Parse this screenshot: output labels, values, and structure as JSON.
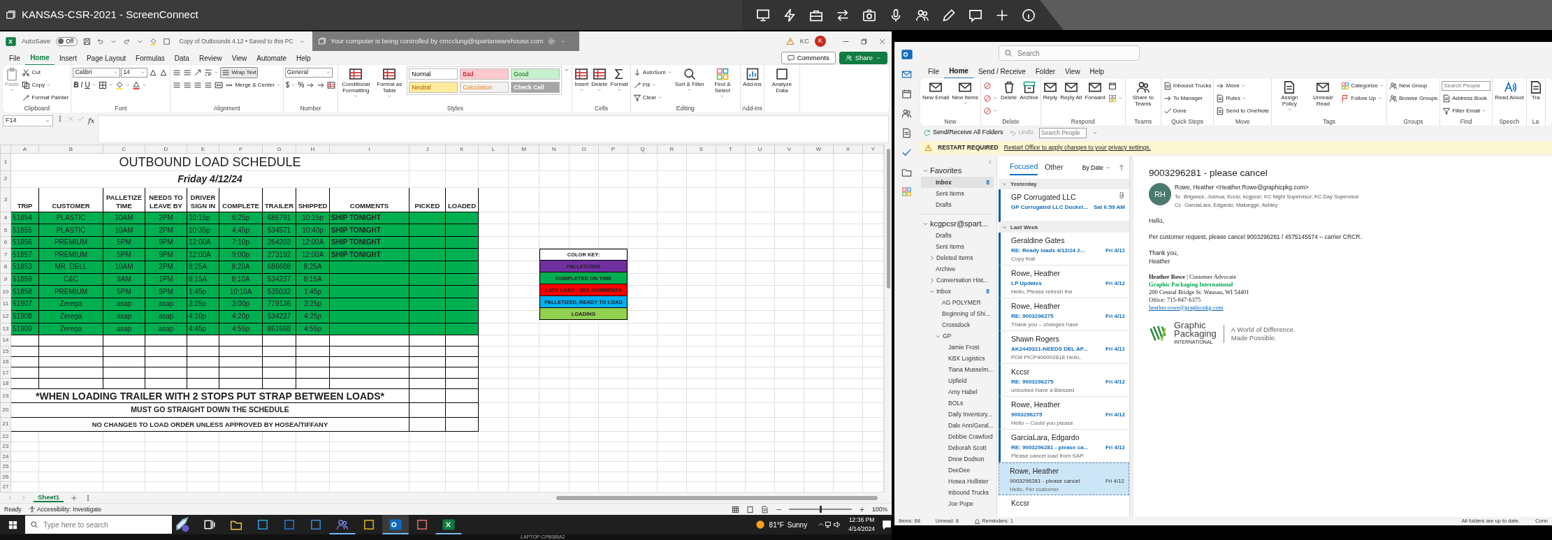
{
  "remote_session": {
    "title": "KANSAS-CSR-2021 - ScreenConnect",
    "banner": "Your computer is being controlled by cmcclung@spartanwarehouse.com"
  },
  "excel": {
    "autosave": {
      "label": "AutoSave",
      "state": "Off",
      "on": false
    },
    "file_title": "Copy of Outbounds 4.12 • Saved to this PC",
    "user": {
      "initials": "KC",
      "avatar": "K"
    },
    "menu_tabs": [
      {
        "label": "File",
        "selected": false
      },
      {
        "label": "Home",
        "selected": true
      },
      {
        "label": "Insert",
        "selected": false
      },
      {
        "label": "Page Layout",
        "selected": false
      },
      {
        "label": "Formulas",
        "selected": false
      },
      {
        "label": "Data",
        "selected": false
      },
      {
        "label": "Review",
        "selected": false
      },
      {
        "label": "View",
        "selected": false
      },
      {
        "label": "Automate",
        "selected": false
      },
      {
        "label": "Help",
        "selected": false
      }
    ],
    "comments": "Comments",
    "share": "Share",
    "ribbon": [
      {
        "label": "Clipboard",
        "items": [
          {
            "kind": "large",
            "label": "Paste",
            "dropdown": true,
            "disabled": true
          },
          {
            "kind": "stack",
            "lines": [
              {
                "items": [
                  {
                    "kind": "button",
                    "label": "Cut"
                  }
                ]
              },
              {
                "items": [
                  {
                    "kind": "button",
                    "label": "Copy",
                    "dropdown": true
                  }
                ]
              },
              {
                "items": [
                  {
                    "kind": "button",
                    "label": "Format Painter"
                  }
                ]
              }
            ]
          }
        ]
      },
      {
        "label": "Font",
        "items": [
          {
            "kind": "stack",
            "lines": [
              {
                "items": [
                  {
                    "kind": "field",
                    "value": "Calibri",
                    "dropdown": true
                  },
                  {
                    "kind": "field",
                    "value": "14",
                    "dropdown": true
                  },
                  {
                    "kind": "icon"
                  },
                  {
                    "kind": "icon"
                  }
                ]
              },
              {
                "items": [
                  {
                    "kind": "bold",
                    "label": "B"
                  },
                  {
                    "kind": "italic",
                    "label": "I"
                  },
                  {
                    "kind": "underline",
                    "label": "U",
                    "dropdown": true
                  },
                  {
                    "kind": "icon",
                    "dropdown": true
                  },
                  {
                    "kind": "icon",
                    "dropdown": true
                  },
                  {
                    "kind": "icon",
                    "dropdown": true
                  }
                ]
              }
            ]
          }
        ]
      },
      {
        "label": "Alignment",
        "items": [
          {
            "kind": "stack",
            "lines": [
              {
                "items": [
                  {
                    "kind": "icon"
                  },
                  {
                    "kind": "icon"
                  },
                  {
                    "kind": "icon"
                  },
                  {
                    "kind": "icon",
                    "dropdown": true
                  },
                  {
                    "kind": "toggle",
                    "label": "Wrap Text",
                    "on": true
                  }
                ]
              },
              {
                "items": [
                  {
                    "kind": "icon"
                  },
                  {
                    "kind": "icon"
                  },
                  {
                    "kind": "icon"
                  },
                  {
                    "kind": "icon"
                  },
                  {
                    "kind": "icon"
                  },
                  {
                    "kind": "button",
                    "label": "Merge & Center",
                    "dropdown": true
                  }
                ]
              }
            ]
          }
        ]
      },
      {
        "label": "Number",
        "items": [
          {
            "kind": "stack",
            "lines": [
              {
                "items": [
                  {
                    "kind": "field",
                    "value": "General",
                    "dropdown": true
                  }
                ]
              },
              {
                "items": [
                  {
                    "kind": "glyph",
                    "label": "$",
                    "dropdown": true
                  },
                  {
                    "kind": "glyph",
                    "label": "%"
                  },
                  {
                    "kind": "icon"
                  },
                  {
                    "kind": "icon"
                  },
                  {
                    "kind": "icon"
                  }
                ]
              }
            ]
          }
        ]
      },
      {
        "label": "Styles",
        "items": [
          {
            "kind": "large",
            "label": "Conditional Formatting",
            "dropdown": true
          },
          {
            "kind": "large",
            "label": "Format as Table",
            "dropdown": true
          },
          {
            "kind": "gallery",
            "styles": [
              {
                "label": "Normal",
                "color": "#ffffff"
              },
              {
                "label": "Bad",
                "color": "#ffc7ce"
              },
              {
                "label": "Good",
                "color": "#c6efce"
              },
              {
                "label": "Neutral",
                "color": "#ffeb9c"
              },
              {
                "label": "Calculation",
                "color": "#f2f2f2"
              },
              {
                "label": "Check Cell",
                "color": "#a5a5a5"
              }
            ]
          }
        ]
      },
      {
        "label": "Cells",
        "items": [
          {
            "kind": "large",
            "label": "Insert",
            "dropdown": true
          },
          {
            "kind": "large",
            "label": "Delete",
            "dropdown": true
          },
          {
            "kind": "large",
            "label": "Format",
            "dropdown": true
          }
        ]
      },
      {
        "label": "Editing",
        "items": [
          {
            "kind": "stack",
            "lines": [
              {
                "items": [
                  {
                    "kind": "button",
                    "label": "AutoSum",
                    "dropdown": true
                  }
                ]
              },
              {
                "items": [
                  {
                    "kind": "button",
                    "label": "Fill",
                    "dropdown": true
                  }
                ]
              },
              {
                "items": [
                  {
                    "kind": "button",
                    "label": "Clear",
                    "dropdown": true
                  }
                ]
              }
            ]
          },
          {
            "kind": "large",
            "label": "Sort & Filter",
            "dropdown": true
          },
          {
            "kind": "large",
            "label": "Find & Select",
            "dropdown": true
          }
        ]
      },
      {
        "label": "Add-ins",
        "items": [
          {
            "kind": "large",
            "label": "Add-ins"
          }
        ]
      },
      {
        "items": [
          {
            "kind": "large",
            "label": "Analyze Data"
          }
        ]
      }
    ],
    "name_box": "F14",
    "function_label": "fx",
    "sheet": {
      "columns": [
        "A",
        "B",
        "C",
        "D",
        "E",
        "F",
        "G",
        "H",
        "I",
        "J",
        "K",
        "L",
        "M",
        "N",
        "O",
        "P",
        "Q",
        "R",
        "S",
        "T",
        "U",
        "V",
        "W",
        "X",
        "Y"
      ],
      "row_numbers": [
        "1",
        "2",
        "3",
        "4",
        "5",
        "6",
        "7",
        "8",
        "9",
        "10",
        "11",
        "12",
        "13",
        "14",
        "15",
        "16",
        "17",
        "18",
        "19",
        "20",
        "21",
        "22",
        "23",
        "24",
        "25",
        "26",
        "27"
      ],
      "title": "OUTBOUND LOAD SCHEDULE",
      "date": "Friday 4/12/24",
      "headers": [
        "TRIP",
        "CUSTOMER",
        "PALLETIZE TIME",
        "NEEDS TO LEAVE BY",
        "DRIVER SIGN IN",
        "COMPLETE",
        "TRAILER",
        "SHIPPED",
        "COMMENTS",
        "PICKED",
        "LOADED"
      ],
      "loads": [
        {
          "trip": "51854",
          "customer": "PLASTIC",
          "palletize": "10AM",
          "leave_by": "2PM",
          "sign_in": "10:15p",
          "complete": "6:25p",
          "trailer": "686791",
          "shipped": "10:15p",
          "comment": "SHIP TONIGHT",
          "color": "#00b050"
        },
        {
          "trip": "51855",
          "customer": "PLASTIC",
          "palletize": "10AM",
          "leave_by": "2PM",
          "sign_in": "10:35p",
          "complete": "4:45p",
          "trailer": "534571",
          "shipped": "10:40p",
          "comment": "SHIP TONIGHT",
          "color": "#00b050"
        },
        {
          "trip": "51856",
          "customer": "PREMIUM",
          "palletize": "5PM",
          "leave_by": "9PM",
          "sign_in": "12:00A",
          "complete": "7:10p",
          "trailer": "264203",
          "shipped": "12:00A",
          "comment": "SHIP TONIGHT",
          "color": "#00b050"
        },
        {
          "trip": "51857",
          "customer": "PREMIUM",
          "palletize": "5PM",
          "leave_by": "9PM",
          "sign_in": "12:00A",
          "complete": "9:00p",
          "trailer": "273192",
          "shipped": "12:00A",
          "comment": "SHIP TONIGHT",
          "color": "#00b050"
        },
        {
          "trip": "51853",
          "customer": "MR. DELL",
          "palletize": "10AM",
          "leave_by": "2PM",
          "sign_in": "8:25A",
          "complete": "8:20A",
          "trailer": "686688",
          "shipped": "8:25A",
          "color": "#00b050"
        },
        {
          "trip": "51859",
          "customer": "C&C",
          "palletize": "9AM",
          "leave_by": "1PM",
          "sign_in": "8:15A",
          "complete": "8:10A",
          "trailer": "534237",
          "shipped": "8:15A",
          "color": "#00b050"
        },
        {
          "trip": "51858",
          "customer": "PREMIUM",
          "palletize": "5PM",
          "leave_by": "9PM",
          "sign_in": "1:45p",
          "complete": "10:10A",
          "trailer": "535032",
          "shipped": "1:45p",
          "color": "#00b050"
        },
        {
          "trip": "51907",
          "customer": "Zerega",
          "palletize": "asap",
          "leave_by": "asap",
          "sign_in": "3:25p",
          "complete": "3:00p",
          "trailer": "779136",
          "shipped": "3:25p",
          "color": "#00b050"
        },
        {
          "trip": "51908",
          "customer": "Zerega",
          "palletize": "asap",
          "leave_by": "asap",
          "sign_in": "4:10p",
          "complete": "4:20p",
          "trailer": "534237",
          "shipped": "4:25p",
          "color": "#00b050"
        },
        {
          "trip": "51909",
          "customer": "Zerega",
          "palletize": "asap",
          "leave_by": "asap",
          "sign_in": "4:45p",
          "complete": "4:55p",
          "trailer": "861668",
          "shipped": "4:55p",
          "color": "#00b050"
        }
      ],
      "notes": [
        "*WHEN LOADING TRAILER WITH 2 STOPS PUT STRAP BETWEEN LOADS*",
        "MUST GO STRAIGHT DOWN THE SCHEDULE",
        "NO CHANGES TO LOAD ORDER UNLESS APPROVED BY HOSEA/TIFFANY"
      ],
      "color_key": {
        "title": "COLOR KEY:",
        "items": [
          {
            "label": "PALLETIZING",
            "color": "#7030a0"
          },
          {
            "label": "COMPLETED ON TIME",
            "color": "#00b050"
          },
          {
            "label": "LATE LOAD - SEE COMMENTS",
            "color": "#ff0000"
          },
          {
            "label": "PALLETIZED, READY TO LOAD",
            "color": "#00b0f0"
          },
          {
            "label": "LOADING",
            "color": "#92d050"
          }
        ]
      }
    },
    "sheet_tabs": [
      {
        "label": "Sheet1",
        "selected": true
      }
    ],
    "status": {
      "ready": "Ready",
      "accessibility": "Accessibility: Investigate",
      "zoom": "100%",
      "level": 0.5
    }
  },
  "taskbar": {
    "search_placeholder": "Type here to search",
    "apps": [
      {
        "running": false,
        "selected": false
      },
      {
        "running": false,
        "selected": false
      },
      {
        "running": false,
        "selected": false
      },
      {
        "running": false,
        "selected": false
      },
      {
        "running": false,
        "selected": false
      },
      {
        "running": true,
        "selected": false
      },
      {
        "running": false,
        "selected": false
      },
      {
        "running": true,
        "selected": true
      },
      {
        "running": false,
        "selected": false
      },
      {
        "running": true,
        "selected": false
      }
    ],
    "temperature": "81°F",
    "condition": "Sunny",
    "time": "12:36 PM",
    "date": "4/14/2024",
    "machine": "LAPTOP-CP8086A2"
  },
  "outlook": {
    "search_placeholder": "Search",
    "tabs": [
      {
        "label": "File",
        "selected": false
      },
      {
        "label": "Home",
        "selected": true
      },
      {
        "label": "Send / Receive",
        "selected": false
      },
      {
        "label": "Folder",
        "selected": false
      },
      {
        "label": "View",
        "selected": false
      },
      {
        "label": "Help",
        "selected": false
      }
    ],
    "ribbon": [
      {
        "label": "New",
        "items": [
          {
            "kind": "large",
            "label": "New Email"
          },
          {
            "kind": "large",
            "label": "New Items",
            "dropdown": true
          }
        ]
      },
      {
        "label": "Delete",
        "items": [
          {
            "kind": "stack",
            "lines": [
              {
                "items": [
                  {
                    "kind": "icon"
                  }
                ]
              },
              {
                "items": [
                  {
                    "kind": "icon",
                    "dropdown": true
                  }
                ]
              },
              {
                "items": [
                  {
                    "kind": "icon",
                    "dropdown": true
                  }
                ]
              }
            ]
          },
          {
            "kind": "large",
            "label": "Delete"
          },
          {
            "kind": "large",
            "label": "Archive"
          }
        ]
      },
      {
        "label": "Respond",
        "items": [
          {
            "kind": "large",
            "label": "Reply"
          },
          {
            "kind": "large",
            "label": "Reply All"
          },
          {
            "kind": "large",
            "label": "Forward"
          },
          {
            "kind": "stack",
            "lines": [
              {
                "items": [
                  {
                    "kind": "icon"
                  }
                ]
              },
              {
                "items": [
                  {
                    "kind": "icon",
                    "dropdown": true
                  }
                ]
              }
            ]
          }
        ]
      },
      {
        "label": "Teams",
        "items": [
          {
            "kind": "large",
            "label": "Share to Teams"
          }
        ]
      },
      {
        "label": "Quick Steps",
        "items": [
          {
            "kind": "stack",
            "lines": [
              {
                "items": [
                  {
                    "kind": "button",
                    "label": "Inbound Trucks"
                  }
                ]
              },
              {
                "items": [
                  {
                    "kind": "button",
                    "label": "To Manager"
                  }
                ]
              },
              {
                "items": [
                  {
                    "kind": "button",
                    "label": "Done"
                  }
                ]
              }
            ]
          }
        ]
      },
      {
        "label": "Move",
        "items": [
          {
            "kind": "stack",
            "lines": [
              {
                "items": [
                  {
                    "kind": "button",
                    "label": "Move",
                    "dropdown": true
                  }
                ]
              },
              {
                "items": [
                  {
                    "kind": "button",
                    "label": "Rules",
                    "dropdown": true
                  }
                ]
              },
              {
                "items": [
                  {
                    "kind": "button",
                    "label": "Send to OneNote"
                  }
                ]
              }
            ]
          }
        ]
      },
      {
        "label": "Tags",
        "items": [
          {
            "kind": "large",
            "label": "Assign Policy",
            "dropdown": true
          },
          {
            "kind": "large",
            "label": "Unread/ Read"
          },
          {
            "kind": "stack",
            "lines": [
              {
                "items": [
                  {
                    "kind": "button",
                    "label": "Categorize",
                    "dropdown": true
                  }
                ]
              },
              {
                "items": [
                  {
                    "kind": "button",
                    "label": "Follow Up",
                    "dropdown": true
                  }
                ]
              }
            ]
          }
        ]
      },
      {
        "label": "Groups",
        "items": [
          {
            "kind": "stack",
            "lines": [
              {
                "items": [
                  {
                    "kind": "button",
                    "label": "New Group"
                  }
                ]
              },
              {
                "items": [
                  {
                    "kind": "button",
                    "label": "Browse Groups"
                  }
                ]
              }
            ]
          }
        ]
      },
      {
        "label": "Find",
        "items": [
          {
            "kind": "stack",
            "lines": [
              {
                "items": [
                  {
                    "kind": "field",
                    "placeholder": "Search People"
                  }
                ]
              },
              {
                "items": [
                  {
                    "kind": "button",
                    "label": "Address Book"
                  }
                ]
              },
              {
                "items": [
                  {
                    "kind": "button",
                    "label": "Filter Email",
                    "dropdown": true
                  }
                ]
              }
            ]
          }
        ]
      },
      {
        "label": "Speech",
        "items": [
          {
            "kind": "large",
            "label": "Read Aloud"
          }
        ]
      },
      {
        "label": "La",
        "items": [
          {
            "kind": "large",
            "label": "Tra"
          }
        ]
      }
    ],
    "quick_access": {
      "send_receive": "Send/Receive All Folders",
      "undo": "Undo",
      "undo_disabled": true,
      "search_placeholder": "Search People"
    },
    "notice": {
      "title": "RESTART REQUIRED",
      "link": "Restart Office to apply changes to your privacy settings."
    },
    "folders": [
      {
        "label": "Favorites",
        "expanded": true,
        "selected": false,
        "children": [
          {
            "label": "Inbox",
            "count": "8",
            "selected": true
          },
          {
            "label": "Sent Items",
            "selected": false
          },
          {
            "label": "Drafts",
            "selected": false
          }
        ]
      },
      {
        "label": "kcgpcsr@spart...",
        "expanded": true,
        "selected": false,
        "children": [
          {
            "label": "Drafts",
            "selected": false
          },
          {
            "label": "Sent Items",
            "selected": false
          },
          {
            "label": "Deleted Items",
            "expanded": false,
            "selected": false
          },
          {
            "label": "Archive",
            "selected": false
          },
          {
            "label": "Conversation Hist...",
            "expanded": false,
            "selected": false
          },
          {
            "label": "Inbox",
            "count": "8",
            "expanded": true,
            "selected": false,
            "children": [
              {
                "label": "AG POLYMER",
                "selected": false
              },
              {
                "label": "Beginning of Shi...",
                "selected": false
              },
              {
                "label": "Crossdock",
                "selected": false
              },
              {
                "label": "GP",
                "expanded": true,
                "selected": false,
                "children": [
                  {
                    "label": "Jamie Frost",
                    "selected": false
                  },
                  {
                    "label": "KBX Logistics",
                    "selected": false
                  },
                  {
                    "label": "Tiana Musselm...",
                    "selected": false
                  },
                  {
                    "label": "Upfield",
                    "selected": false
                  },
                  {
                    "label": "Amy Habel",
                    "selected": false
                  },
                  {
                    "label": "BOLs",
                    "selected": false
                  },
                  {
                    "label": "Daily Inventory...",
                    "selected": false
                  },
                  {
                    "label": "Dale Ann/Geral...",
                    "selected": false
                  },
                  {
                    "label": "Debbie Crawford",
                    "selected": false
                  },
                  {
                    "label": "Deborah Scott",
                    "selected": false
                  },
                  {
                    "label": "Drew Dodson",
                    "selected": false
                  },
                  {
                    "label": "DeeDee",
                    "selected": false
                  },
                  {
                    "label": "Hosea Hollister",
                    "selected": false
                  },
                  {
                    "label": "Inbound Trucks",
                    "selected": false
                  },
                  {
                    "label": "Joe Pope",
                    "selected": false
                  }
                ]
              }
            ]
          }
        ]
      }
    ],
    "list": {
      "tabs": [
        {
          "label": "Focused",
          "selected": true
        },
        {
          "label": "Other",
          "selected": false
        }
      ],
      "sort": "By Date",
      "groups": [
        {
          "label": "Yesterday",
          "expanded": true,
          "messages": [
            {
              "sender": "GP Corrugated LLC",
              "subject": "GP Corrugated LLC Docket...",
              "date": "Sat 6:59 AM",
              "attachment": true,
              "unread": true,
              "selected": false
            }
          ]
        },
        {
          "label": "Last Week",
          "expanded": true,
          "messages": [
            {
              "sender": "Geraldine Gates",
              "subject": "RE: Ready loads 4/12/24 2...",
              "date": "Fri 4/12",
              "preview": "Copy that",
              "attachment": false,
              "unread": true,
              "selected": false
            },
            {
              "sender": "Rowe, Heather",
              "subject": "LP Updates",
              "date": "Fri 4/12",
              "preview": "Hello,   Please refresh the",
              "attachment": false,
              "unread": true,
              "selected": false
            },
            {
              "sender": "Rowe, Heather",
              "subject": "RE: 9003296275",
              "date": "Fri 4/12",
              "preview": "Thank you – changes have",
              "attachment": false,
              "unread": true,
              "selected": false
            },
            {
              "sender": "Shawn Rogers",
              "subject": "AK2449321-NEEDS DEL AP...",
              "date": "Fri 4/12",
              "preview": "PO#  PICP406002818  Hello,",
              "attachment": false,
              "unread": true,
              "selected": false
            },
            {
              "sender": "Kccsr",
              "subject": "RE: 9003296275",
              "date": "Fri 4/12",
              "preview": "unlocked  Have a Blessed",
              "attachment": false,
              "unread": true,
              "selected": false
            },
            {
              "sender": "Rowe, Heather",
              "subject": "9003296275",
              "date": "Fri 4/12",
              "preview": "Hello –   Could you please",
              "attachment": false,
              "unread": true,
              "selected": false
            },
            {
              "sender": "GarciaLara, Edgardo",
              "subject": "RE: 9003296281 - please ca...",
              "date": "Fri 4/12",
              "preview": "Please cancel load from SAP.",
              "attachment": false,
              "unread": true,
              "selected": false
            },
            {
              "sender": "Rowe, Heather",
              "subject": "9003296281 - please cancel",
              "date": "Fri 4/12",
              "preview": "Hello,   Per customer",
              "attachment": false,
              "unread": false,
              "selected": true
            },
            {
              "sender": "Kccsr",
              "attachment": false,
              "unread": false,
              "selected": false
            }
          ]
        }
      ]
    },
    "message": {
      "subject": "9003296281 - please cancel",
      "initials": "RH",
      "from": "Rowe, Heather <Heather.Rowe@graphicpkg.com>",
      "to_label": "To",
      "to": "Brigance, Joshua; Kccsr; kcgpcsr; KC Night Supervisor; KC Day Supervisor",
      "cc_label": "Cc",
      "cc": "GarciaLara, Edgardo; Maluegge, Ashley",
      "body": [
        [
          "Hello,"
        ],
        [
          "Per customer request, please cancel 9003296281 / 4575145574 – carrier CRCR."
        ],
        [
          "Thank you,",
          "Heather"
        ]
      ],
      "signature": {
        "line": "**Heather Rowe**  |  Customer Advocate",
        "company": "Graphic Packaging International",
        "address": "200 Central Bridge St.  Wausau,  WI 54401",
        "phone": "Office:  715-847-6375",
        "email": "heather.rowe@graphicpkg.com"
      },
      "logo": {
        "name_lines": [
          "Graphic",
          "Packaging"
        ],
        "subtitle": "INTERNATIONAL",
        "tagline_lines": [
          "A World of Difference.",
          "Made Possible."
        ]
      }
    },
    "status": {
      "items": "Items: 68",
      "unread": "Unread: 8",
      "reminders": "Reminders: 1",
      "sync": "All folders are up to date.",
      "connection": "Conn"
    }
  }
}
